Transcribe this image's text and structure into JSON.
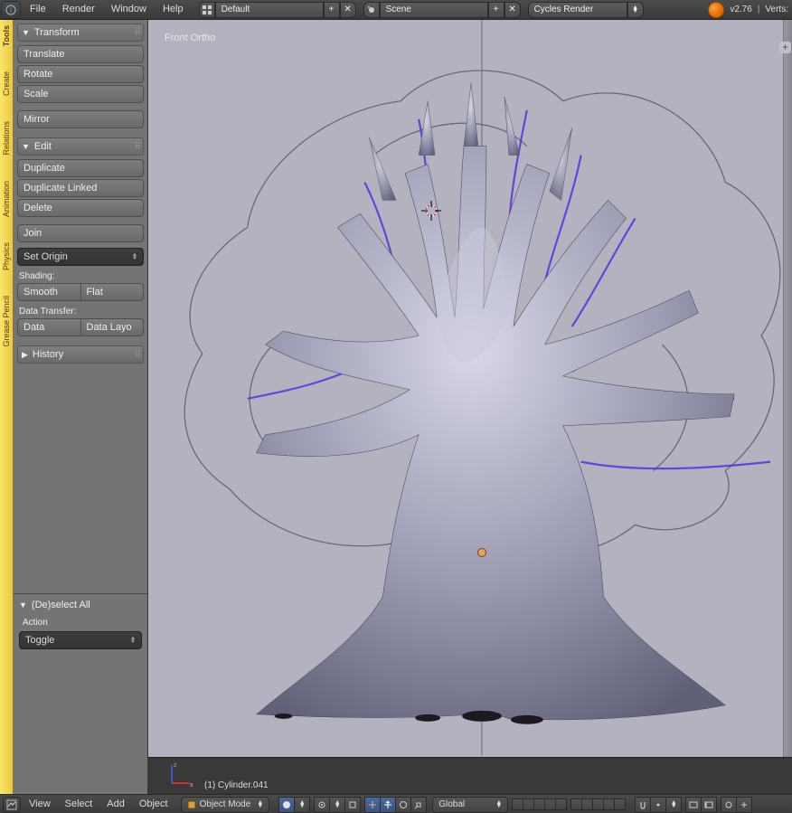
{
  "topbar": {
    "menus": [
      "File",
      "Render",
      "Window",
      "Help"
    ],
    "layout_label": "Default",
    "scene_label": "Scene",
    "engine_label": "Cycles Render",
    "version": "v2.76",
    "stats": "Verts:"
  },
  "toolshelf": {
    "tabs": [
      "Tools",
      "Create",
      "Relations",
      "Animation",
      "Physics",
      "Grease Pencil"
    ],
    "transform": {
      "header": "Transform",
      "translate": "Translate",
      "rotate": "Rotate",
      "scale": "Scale",
      "mirror": "Mirror"
    },
    "edit": {
      "header": "Edit",
      "duplicate": "Duplicate",
      "duplicate_linked": "Duplicate Linked",
      "delete": "Delete",
      "join": "Join",
      "set_origin": "Set Origin"
    },
    "shading": {
      "label": "Shading:",
      "smooth": "Smooth",
      "flat": "Flat"
    },
    "datatransfer": {
      "label": "Data Transfer:",
      "data": "Data",
      "data_layo": "Data Layo"
    },
    "history_header": "History",
    "operator": {
      "header": "(De)select All",
      "action_label": "Action",
      "action_value": "Toggle"
    }
  },
  "viewport": {
    "view_label": "Front Ortho",
    "object_name": "(1) Cylinder.041"
  },
  "bottombar": {
    "menus": [
      "View",
      "Select",
      "Add",
      "Object"
    ],
    "mode": "Object Mode",
    "orientation": "Global"
  }
}
